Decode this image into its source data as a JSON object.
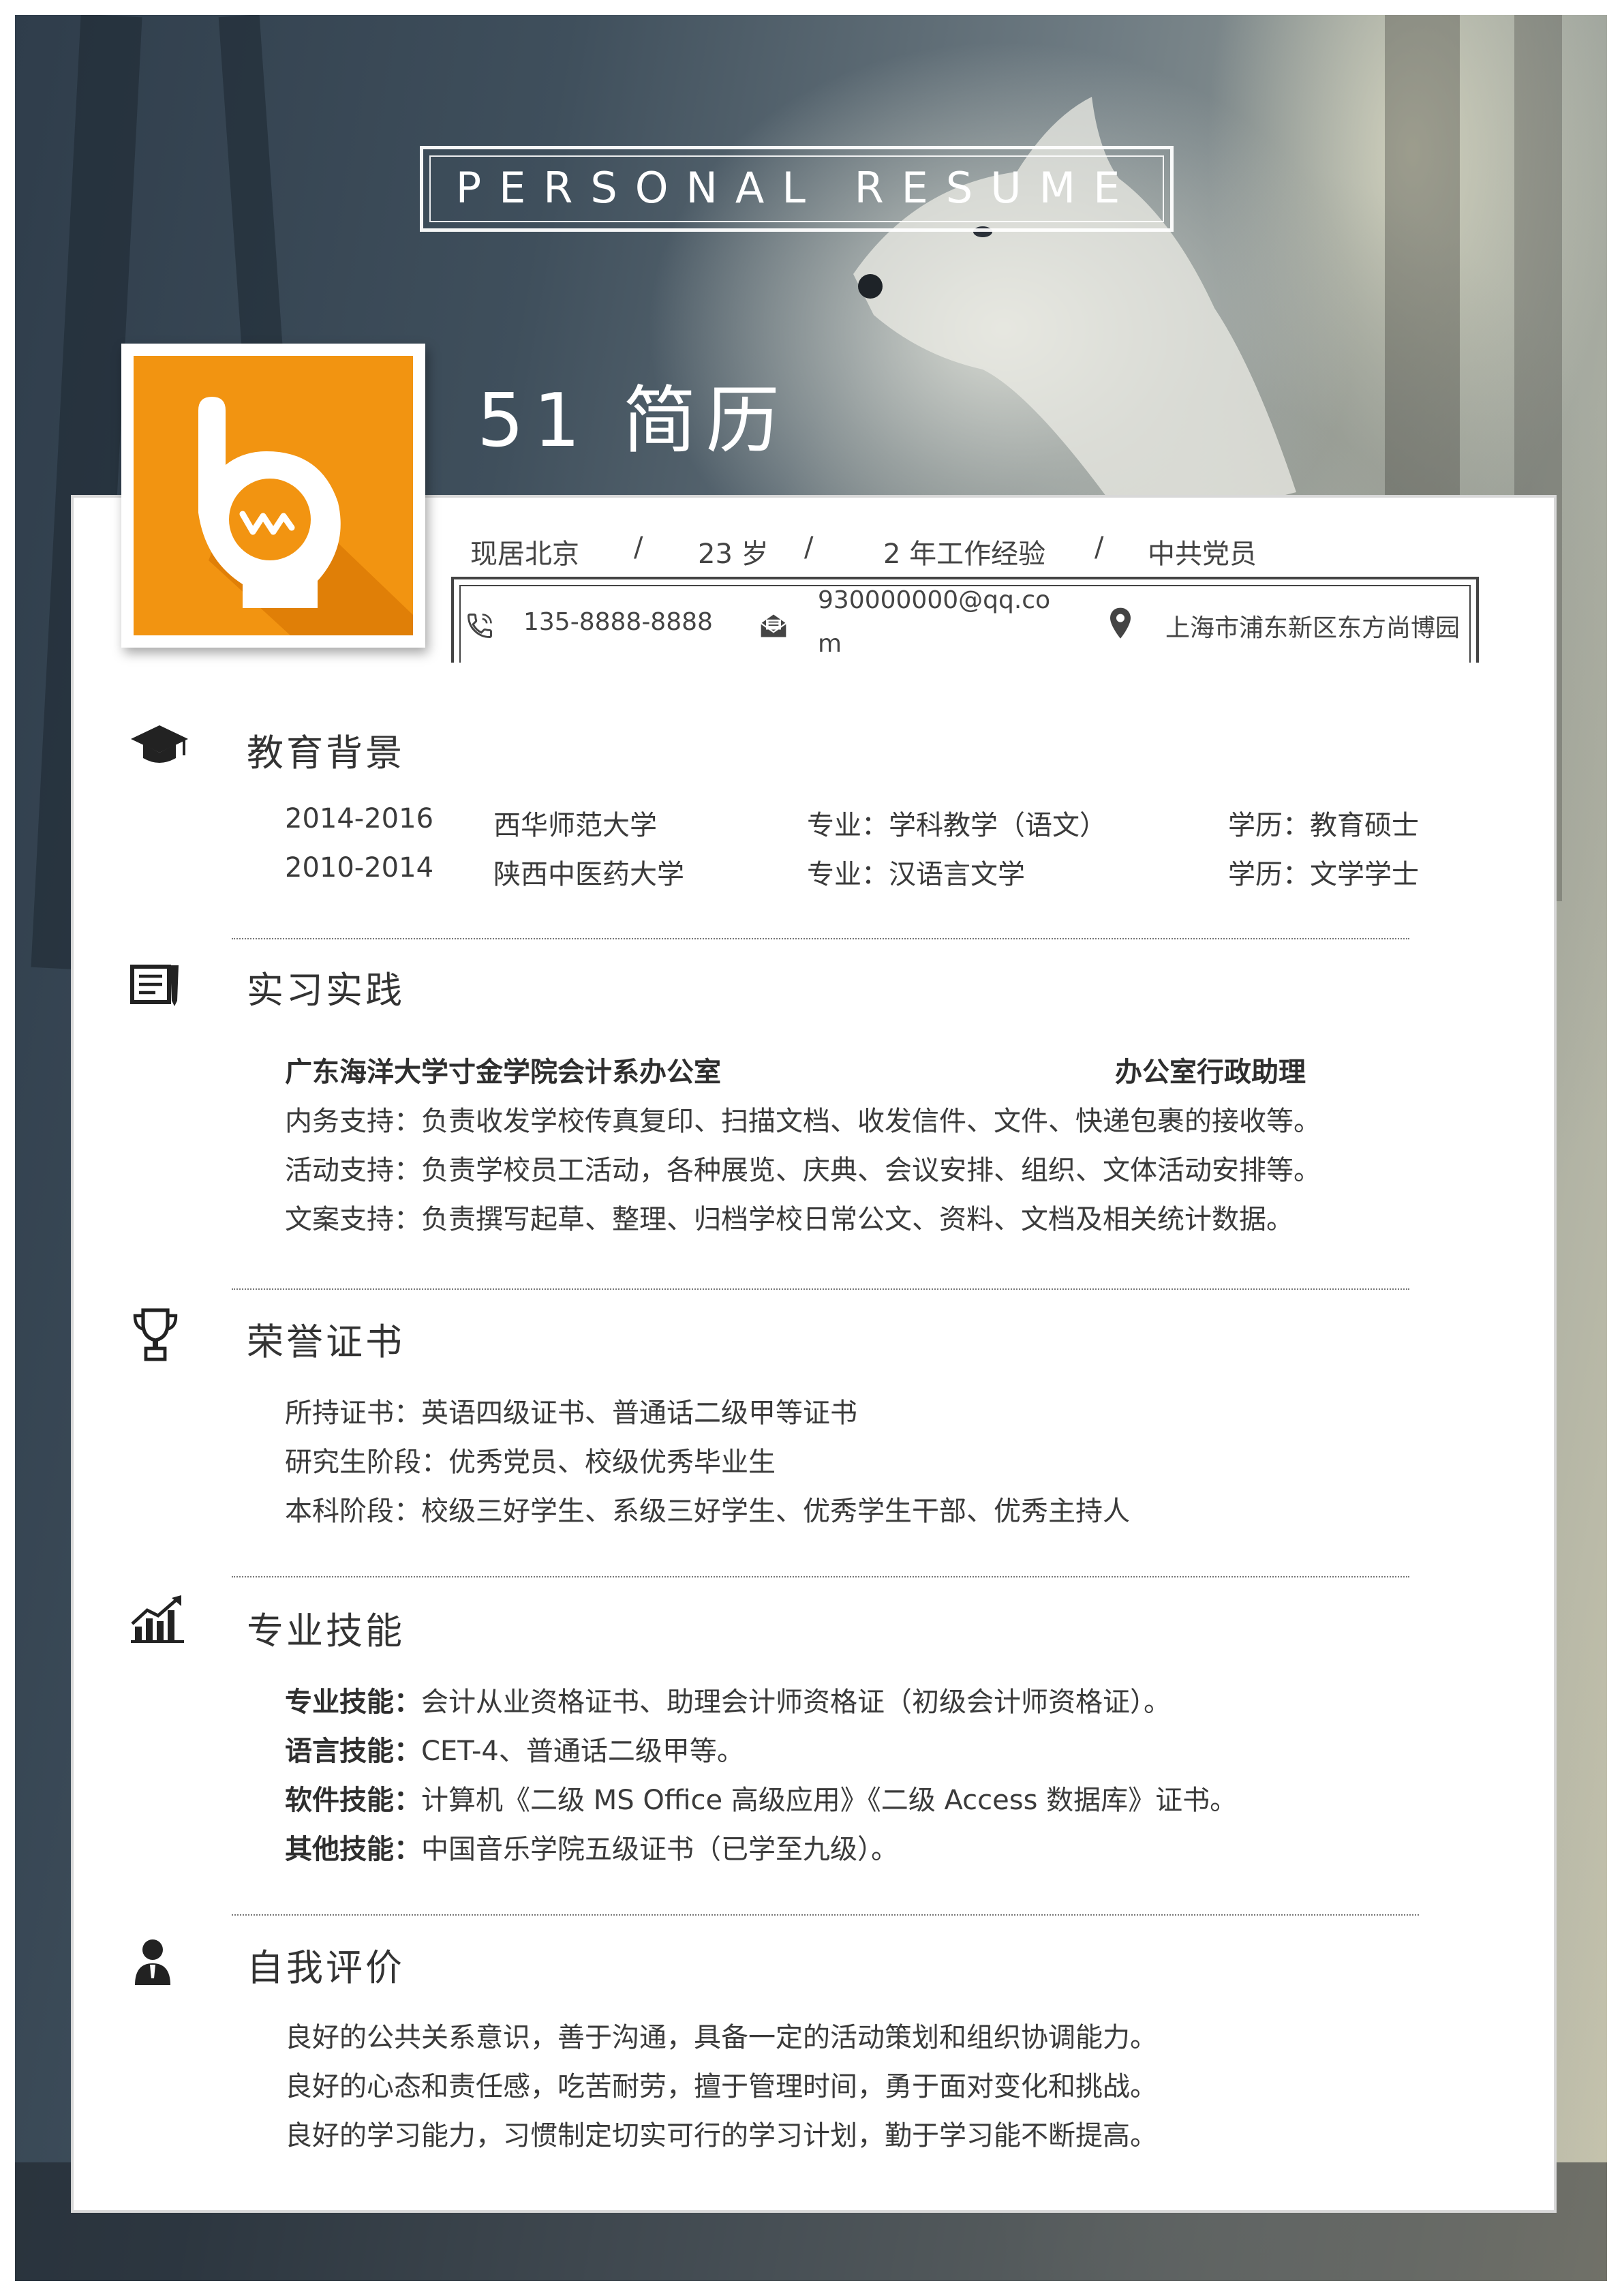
{
  "header": {
    "title": "PERSONAL RESUME",
    "name": "51 简历"
  },
  "profile": {
    "location": "现居北京",
    "age": "23 岁",
    "experience": "2 年工作经验",
    "political": "中共党员",
    "separator": "/"
  },
  "contact": {
    "phone": "135-8888-8888",
    "email_line1": "930000000@qq.co",
    "email_line2": "m",
    "address": "上海市浦东新区东方尚博园"
  },
  "sections": {
    "education": {
      "title": "教育背景",
      "rows": [
        {
          "years": "2014-2016",
          "school": "西华师范大学",
          "major": "专业：学科教学（语文）",
          "degree": "学历：教育硕士"
        },
        {
          "years": "2010-2014",
          "school": "陕西中医药大学",
          "major": "专业：汉语言文学",
          "degree": "学历：文学学士"
        }
      ]
    },
    "internship": {
      "title": "实习实践",
      "org": "广东海洋大学寸金学院会计系办公室",
      "role": "办公室行政助理",
      "lines": [
        "内务支持：负责收发学校传真复印、扫描文档、收发信件、文件、快递包裹的接收等。",
        "活动支持：负责学校员工活动，各种展览、庆典、会议安排、组织、文体活动安排等。",
        "文案支持：负责撰写起草、整理、归档学校日常公文、资料、文档及相关统计数据。"
      ]
    },
    "honors": {
      "title": "荣誉证书",
      "lines": [
        "所持证书：英语四级证书、普通话二级甲等证书",
        "研究生阶段：优秀党员、校级优秀毕业生",
        "本科阶段：校级三好学生、系级三好学生、优秀学生干部、优秀主持人"
      ]
    },
    "skills": {
      "title": "专业技能",
      "items": [
        {
          "label": "专业技能：",
          "text": "会计从业资格证书、助理会计师资格证（初级会计师资格证）。"
        },
        {
          "label": "语言技能：",
          "text": "CET-4、普通话二级甲等。"
        },
        {
          "label": "软件技能：",
          "text": "计算机《二级 MS Office 高级应用》《二级 Access 数据库》证书。"
        },
        {
          "label": "其他技能：",
          "text": "中国音乐学院五级证书（已学至九级）。"
        }
      ]
    },
    "self": {
      "title": "自我评价",
      "lines": [
        "良好的公共关系意识，善于沟通，具备一定的活动策划和组织协调能力。",
        "良好的心态和责任感，吃苦耐劳，擅于管理时间，勇于面对变化和挑战。",
        "良好的学习能力，习惯制定切实可行的学习计划，勤于学习能不断提高。"
      ]
    }
  },
  "icons": {
    "education": "graduation-cap-icon",
    "internship": "notebook-pen-icon",
    "honors": "trophy-icon",
    "skills": "bar-chart-growth-icon",
    "self": "person-icon"
  },
  "colors": {
    "logo_orange": "#f29411",
    "text_dark": "#333333"
  }
}
